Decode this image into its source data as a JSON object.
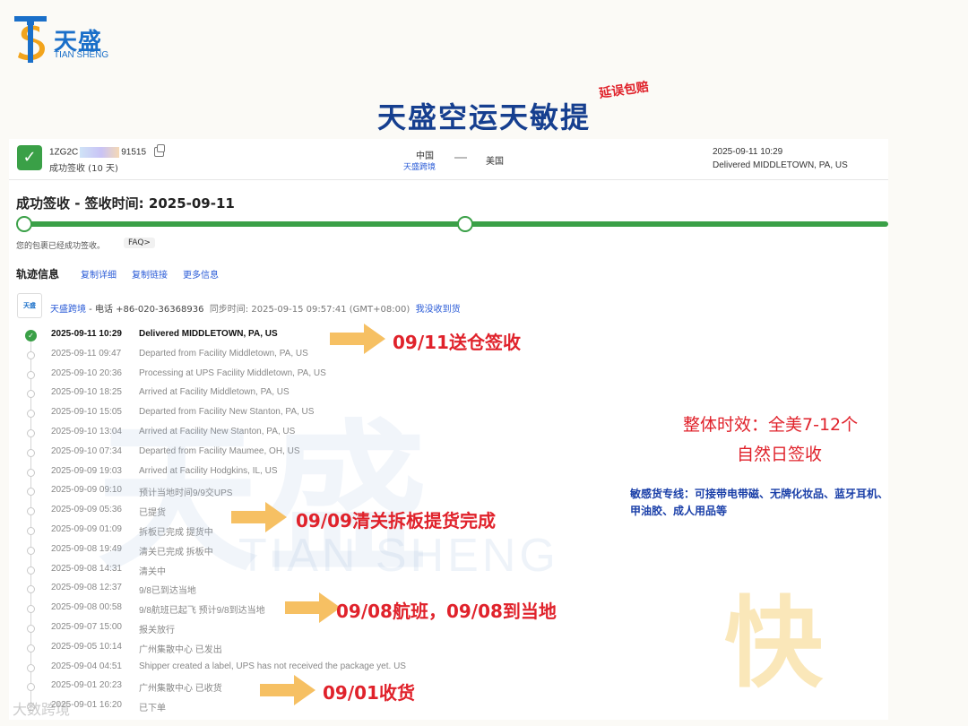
{
  "brand": {
    "name": "天盛",
    "sub": "TIAN SHENG",
    "colors": {
      "primary": "#1a6fc9",
      "accent": "#f2a41c",
      "title": "#163f8f",
      "highlight": "#e0222b",
      "success": "#3aa047",
      "link": "#2a5bd7"
    }
  },
  "title": "天盛空运天敏提",
  "title_tag": "延误包赔",
  "summary": {
    "tracking_prefix": "1ZG2C",
    "tracking_suffix": "91515",
    "status": "成功签收 (10 天)",
    "origin": "中国",
    "origin_carrier": "天盛跨境",
    "destination": "美国",
    "latest_time": "2025-09-11 10:29",
    "latest_event": "Delivered MIDDLETOWN, PA, US"
  },
  "signed_heading": "成功签收 - 签收时间: 2025-09-11",
  "progress_fraction": 1.0,
  "note": "您的包裹已经成功签收。",
  "faq": "FAQ>",
  "tracking_section": {
    "title": "轨迹信息",
    "links": [
      "复制详细",
      "复制链接",
      "更多信息"
    ]
  },
  "carrier": {
    "logo_text": "天盛",
    "name": "天盛跨境",
    "phone": " - 电话 +86-020-36368936",
    "sync": "同步时间: 2025-09-15 09:57:41 (GMT+08:00)",
    "not_received": "我没收到货"
  },
  "events": [
    {
      "time": "2025-09-11 10:29",
      "desc": "Delivered MIDDLETOWN, PA, US"
    },
    {
      "time": "2025-09-11 09:47",
      "desc": "Departed from Facility Middletown, PA, US"
    },
    {
      "time": "2025-09-10 20:36",
      "desc": "Processing at UPS Facility Middletown, PA, US"
    },
    {
      "time": "2025-09-10 18:25",
      "desc": "Arrived at Facility Middletown, PA, US"
    },
    {
      "time": "2025-09-10 15:05",
      "desc": "Departed from Facility New Stanton, PA, US"
    },
    {
      "time": "2025-09-10 13:04",
      "desc": "Arrived at Facility New Stanton, PA, US"
    },
    {
      "time": "2025-09-10 07:34",
      "desc": "Departed from Facility Maumee, OH, US"
    },
    {
      "time": "2025-09-09 19:03",
      "desc": "Arrived at Facility Hodgkins, IL, US"
    },
    {
      "time": "2025-09-09 09:10",
      "desc": "预计当地时间9/9交UPS"
    },
    {
      "time": "2025-09-09 05:36",
      "desc": "已提货"
    },
    {
      "time": "2025-09-09 01:09",
      "desc": "拆板已完成 提货中"
    },
    {
      "time": "2025-09-08 19:49",
      "desc": "清关已完成 拆板中"
    },
    {
      "time": "2025-09-08 14:31",
      "desc": "清关中"
    },
    {
      "time": "2025-09-08 12:37",
      "desc": "9/8已到达当地"
    },
    {
      "time": "2025-09-08 00:58",
      "desc": "9/8航班已起飞 预计9/8到达当地"
    },
    {
      "time": "2025-09-07 15:00",
      "desc": "报关放行"
    },
    {
      "time": "2025-09-05 10:14",
      "desc": "广州集散中心 已发出"
    },
    {
      "time": "2025-09-04 04:51",
      "desc": "Shipper created a label, UPS has not received the package yet. US"
    },
    {
      "time": "2025-09-01 20:23",
      "desc": "广州集散中心 已收货"
    },
    {
      "time": "2025-09-01 16:20",
      "desc": "已下单"
    }
  ],
  "annotations": {
    "delivered": "09/11送仓签收",
    "cleared": "09/09清关拆板提货完成",
    "flight": "09/08航班，09/08到当地",
    "received": "09/01收货"
  },
  "side_notes": {
    "timing_line1": "整体时效：全美7-12个",
    "timing_line2": "自然日签收",
    "sensitive_line1": "敏感货专线：可接带电带磁、无牌化妆品、蓝牙耳机、",
    "sensitive_line2": "甲油胶、成人用品等"
  },
  "watermarks": {
    "big": "天盛",
    "sub": "TIAN SHENG",
    "kuai": "快",
    "corner": "大数跨境"
  },
  "icons": [
    "logo-icon",
    "check-icon",
    "copy-icon",
    "route-arrow-icon",
    "carrier-logo-icon",
    "arrow-icon"
  ]
}
